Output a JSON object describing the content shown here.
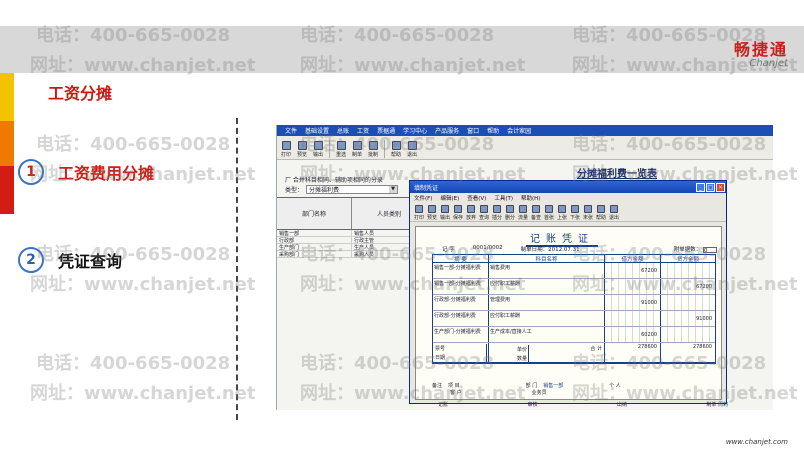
{
  "brand": {
    "name": "畅捷通",
    "sub": "Chanjet"
  },
  "page_title": "工资分摊",
  "steps": [
    {
      "num": "1",
      "label": "工资费用分摊"
    },
    {
      "num": "2",
      "label": "凭证查询"
    }
  ],
  "watermark": {
    "phone": "电话：400-665-0028",
    "site": "网址：www.chanjet.net"
  },
  "app": {
    "menu": [
      "文件",
      "基础设置",
      "总账",
      "工资",
      "票据通",
      "学习中心",
      "产品服务",
      "窗口",
      "帮助",
      "会计家园"
    ],
    "toolbar": [
      "打印",
      "预览",
      "输出",
      "重选",
      "制单",
      "批制",
      "帮助",
      "退出"
    ],
    "option_text": "厂 合并科目相同、辅助项相同的分录",
    "type_label": "类型：",
    "type_value": "分摊福利费",
    "sheet_title": "分摊福利费一览表",
    "grid_headers": [
      "部门名称",
      "人员类别"
    ],
    "grid_rows": [
      [
        "销售一部",
        "销售人员"
      ],
      [
        "行政部",
        "行政主管"
      ],
      [
        "生产部门",
        "生产人员"
      ],
      [
        "采购部门",
        "采购人员"
      ]
    ]
  },
  "dialog": {
    "title": "填制凭证",
    "menu": [
      "文件(F)",
      "编辑(E)",
      "查看(V)",
      "工具(T)",
      "帮助(H)"
    ],
    "toolbar": [
      "打印",
      "预览",
      "输出",
      "保存",
      "放弃",
      "查询",
      "插分",
      "删分",
      "流量",
      "备查",
      "首张",
      "上张",
      "下张",
      "末张",
      "帮助",
      "退出"
    ],
    "voucher_title": "记账凭证",
    "voucher_type": "记  字",
    "voucher_no": "0001/0002",
    "date_label": "制单日期：",
    "date": "2012.07.31",
    "attach_label": "附单据数：",
    "attach_value": "0",
    "columns": [
      "摘  要",
      "科目名称",
      "借方金额",
      "贷方金额"
    ],
    "entries": [
      {
        "summary": "销售一部-分摊福利费",
        "account": "销售费用",
        "debit": "67200",
        "credit": ""
      },
      {
        "summary": "销售一部-分摊福利费",
        "account": "应付职工薪酬",
        "debit": "",
        "credit": "67200"
      },
      {
        "summary": "行政部-分摊福利费",
        "account": "管理费用",
        "debit": "91000",
        "credit": ""
      },
      {
        "summary": "行政部-分摊福利费",
        "account": "应付职工薪酬",
        "debit": "",
        "credit": "91000"
      },
      {
        "summary": "生产部门-分摊福利费",
        "account": "生产成本/直接人工",
        "debit": "60200",
        "credit": ""
      }
    ],
    "sum_labels": {
      "ticket": "票号",
      "date": "日期",
      "qty": "数量",
      "unit_price": "单价",
      "total": "合 计"
    },
    "totals": {
      "debit": "278600",
      "credit": "278600"
    },
    "footer": {
      "remark": "备注",
      "project": "项  目",
      "dept_label": "部  门",
      "dept_value": "销售一部",
      "person": "个  人",
      "customer": "客  户",
      "salesman": "业务员"
    },
    "sign": {
      "bookkeeper": "记账",
      "auditor": "审核",
      "cashier": "出纳",
      "maker": "制单",
      "maker_value": "周莉"
    }
  },
  "footer_url": "www.chanjet.com"
}
